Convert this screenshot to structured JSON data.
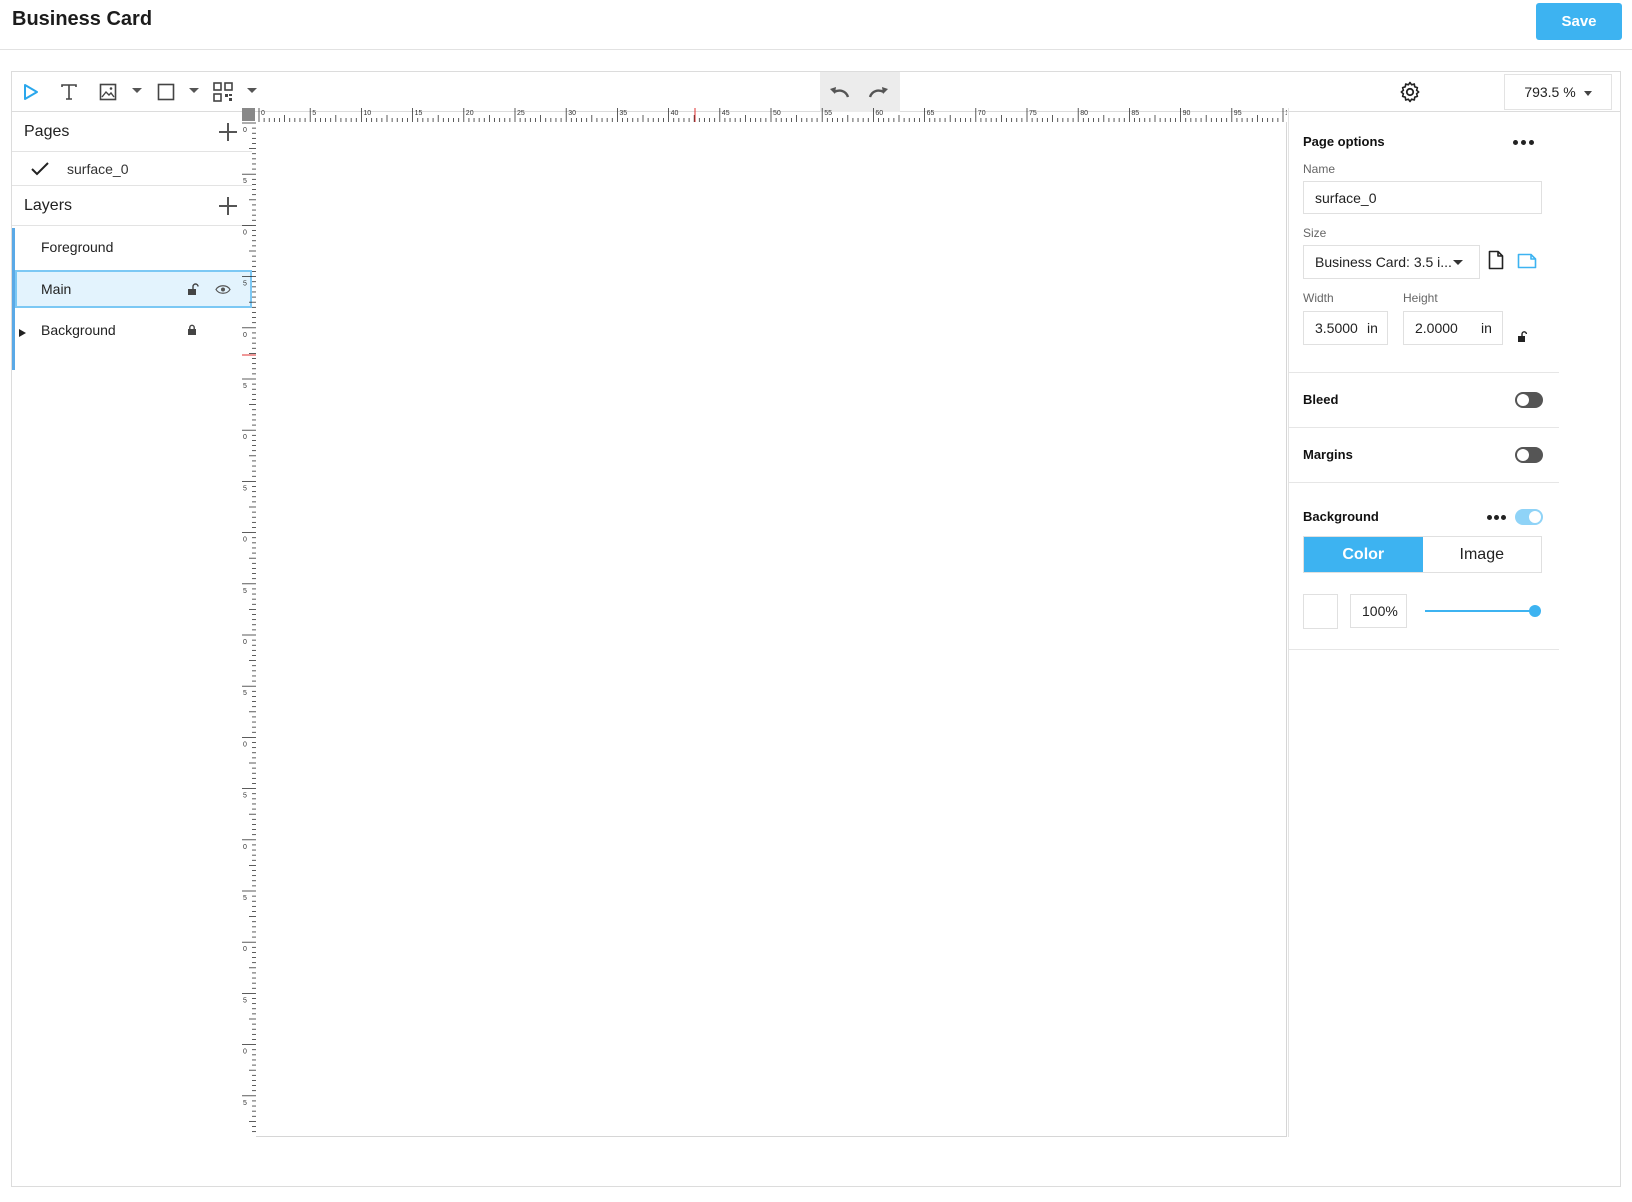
{
  "header": {
    "title": "Business Card",
    "save_label": "Save"
  },
  "toolbar": {
    "tools": [
      "select-icon",
      "text-icon",
      "image-icon",
      "rectangle-icon",
      "qr-code-icon"
    ],
    "zoom": "793.5 %"
  },
  "pages": {
    "title": "Pages",
    "items": [
      {
        "label": "surface_0",
        "checked": true
      }
    ]
  },
  "layers": {
    "title": "Layers",
    "items": [
      {
        "label": "Foreground"
      },
      {
        "label": "Main",
        "selected": true
      },
      {
        "label": "Background",
        "locked": true
      }
    ]
  },
  "ruler": {
    "top_labels": [
      "0",
      "5",
      "10",
      "15",
      "20",
      "25",
      "30",
      "35",
      "40",
      "45",
      "50",
      "55",
      "60",
      "65",
      "70",
      "75",
      "80",
      "85",
      "90",
      "95",
      "1"
    ],
    "left_labels": [
      "0",
      "5",
      "0",
      "5",
      "0",
      "5",
      "0",
      "5",
      "0",
      "5",
      "0",
      "5",
      "0",
      "5",
      "0",
      "5",
      "0",
      "5",
      "0",
      "5"
    ]
  },
  "page_options": {
    "title": "Page options",
    "name_label": "Name",
    "name_value": "surface_0",
    "size_label": "Size",
    "size_value": "Business Card: 3.5 i...",
    "width_label": "Width",
    "width_value": "3.5000",
    "width_unit": "in",
    "height_label": "Height",
    "height_value": "2.0000",
    "height_unit": "in",
    "bleed_label": "Bleed",
    "bleed_on": false,
    "margins_label": "Margins",
    "margins_on": false,
    "background_label": "Background",
    "background_on": true,
    "tab_color": "Color",
    "tab_image": "Image",
    "opacity_value": "100%",
    "opacity_level": 1.0
  },
  "colors": {
    "accent": "#3db3f1",
    "selected_bg": "#e3f3fd"
  }
}
